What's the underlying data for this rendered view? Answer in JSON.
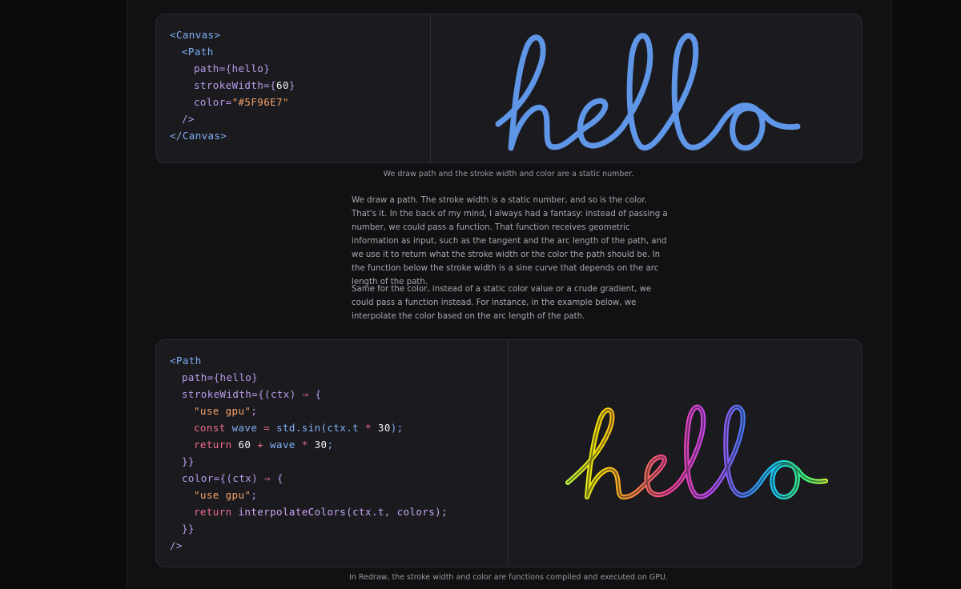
{
  "example1": {
    "code": [
      {
        "indent": 0,
        "parts": [
          {
            "t": "<Canvas>",
            "c": "tag"
          }
        ]
      },
      {
        "indent": 1,
        "parts": [
          {
            "t": "<Path",
            "c": "tag"
          }
        ]
      },
      {
        "indent": 2,
        "parts": [
          {
            "t": "path={",
            "c": "attr"
          },
          {
            "t": "hello",
            "c": "attr"
          },
          {
            "t": "}",
            "c": "attr"
          }
        ]
      },
      {
        "indent": 2,
        "parts": [
          {
            "t": "strokeWidth={",
            "c": "attr"
          },
          {
            "t": "60",
            "c": "num"
          },
          {
            "t": "}",
            "c": "attr"
          }
        ]
      },
      {
        "indent": 2,
        "parts": [
          {
            "t": "color=",
            "c": "attr"
          },
          {
            "t": "\"#5F96E7\"",
            "c": "str"
          }
        ]
      },
      {
        "indent": 1,
        "parts": [
          {
            "t": "/>",
            "c": "attr"
          }
        ]
      },
      {
        "indent": 0,
        "parts": [
          {
            "t": "</Canvas>",
            "c": "tag"
          }
        ]
      }
    ],
    "art_text": "hello",
    "art_color": "#5F96E7",
    "caption": "We draw path and the stroke width and color are a static number."
  },
  "paragraphs": [
    "We draw a path. The stroke width is a static number, and so is the color. That's it. In the back of my mind, I always had a fantasy: instead of passing a number, we could pass a function. That function receives geometric information as input, such as the tangent and the arc length of the path, and we use it to return what the stroke width or the color the path should be. In the function below the stroke width is a sine curve that depends on the arc length of the path.",
    "Same for the color, instead of a static color value or a crude gradient, we could pass a function instead. For instance, in the example below, we interpolate the color based on the arc length of the path."
  ],
  "example2": {
    "code": [
      {
        "indent": 0,
        "parts": [
          {
            "t": "<Path",
            "c": "tag"
          }
        ]
      },
      {
        "indent": 1,
        "parts": [
          {
            "t": "path={hello}",
            "c": "attr"
          }
        ]
      },
      {
        "indent": 1,
        "parts": [
          {
            "t": "strokeWidth={(ctx) ",
            "c": "attr"
          },
          {
            "t": "⇒",
            "c": "op"
          },
          {
            "t": " {",
            "c": "attr"
          }
        ]
      },
      {
        "indent": 2,
        "parts": [
          {
            "t": "\"use gpu\"",
            "c": "str"
          },
          {
            "t": ";",
            "c": "attr"
          }
        ]
      },
      {
        "indent": 2,
        "parts": [
          {
            "t": "const ",
            "c": "kw"
          },
          {
            "t": "wave ",
            "c": "var"
          },
          {
            "t": "= ",
            "c": "op"
          },
          {
            "t": "std.sin(ctx.t ",
            "c": "var"
          },
          {
            "t": "* ",
            "c": "op"
          },
          {
            "t": "30",
            "c": "num"
          },
          {
            "t": ");",
            "c": "var"
          }
        ]
      },
      {
        "indent": 2,
        "parts": [
          {
            "t": "return ",
            "c": "kw"
          },
          {
            "t": "60 ",
            "c": "num"
          },
          {
            "t": "+ ",
            "c": "op"
          },
          {
            "t": "wave ",
            "c": "var"
          },
          {
            "t": "* ",
            "c": "op"
          },
          {
            "t": "30",
            "c": "num"
          },
          {
            "t": ";",
            "c": "var"
          }
        ]
      },
      {
        "indent": 1,
        "parts": [
          {
            "t": "}}",
            "c": "attr"
          }
        ]
      },
      {
        "indent": 1,
        "parts": [
          {
            "t": "color={(ctx) ",
            "c": "attr"
          },
          {
            "t": "⇒",
            "c": "op"
          },
          {
            "t": " {",
            "c": "attr"
          }
        ]
      },
      {
        "indent": 2,
        "parts": [
          {
            "t": "\"use gpu\"",
            "c": "str"
          },
          {
            "t": ";",
            "c": "attr"
          }
        ]
      },
      {
        "indent": 2,
        "parts": [
          {
            "t": "return ",
            "c": "kw"
          },
          {
            "t": "interpolateColors(ctx.t, colors);",
            "c": "fn"
          }
        ]
      },
      {
        "indent": 1,
        "parts": [
          {
            "t": "}}",
            "c": "attr"
          }
        ]
      },
      {
        "indent": 0,
        "parts": [
          {
            "t": "/>",
            "c": "attr"
          }
        ]
      }
    ],
    "art_text": "hello",
    "caption": "In Redraw, the stroke width and color are functions compiled and executed on GPU."
  },
  "colors": {
    "background": "#0b0b0c",
    "panel": "#1b1b1f",
    "accent_blue": "#5F96E7",
    "rainbow": [
      "#ffe600",
      "#ff8a3d",
      "#ff3fa0",
      "#c84bff",
      "#4a7bff",
      "#19d3ff",
      "#3dff7a",
      "#c8ff3d"
    ]
  }
}
